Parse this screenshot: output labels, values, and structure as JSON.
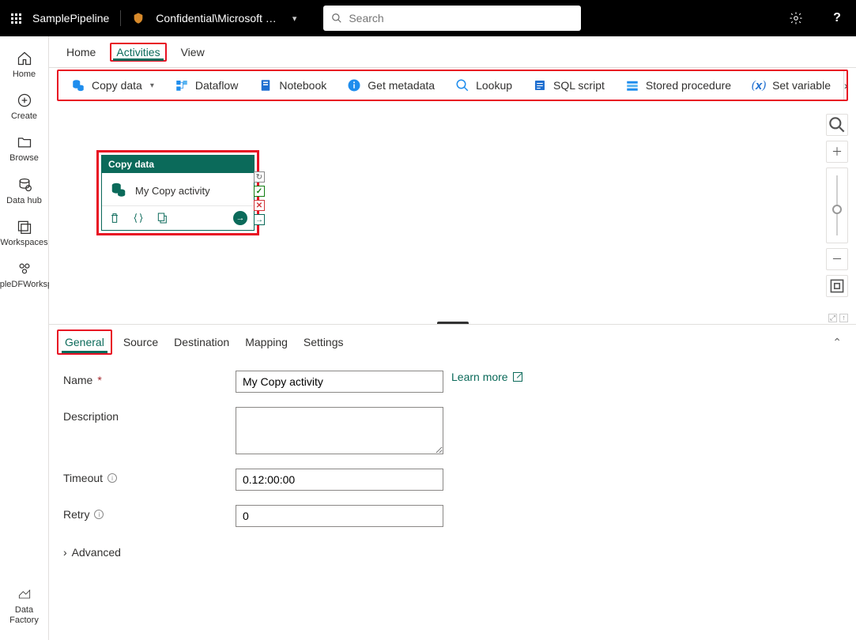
{
  "topbar": {
    "pipeline_name": "SamplePipeline",
    "workspace_label": "Confidential\\Microsoft …",
    "search_placeholder": "Search"
  },
  "leftrail": {
    "home": "Home",
    "create": "Create",
    "browse": "Browse",
    "datahub": "Data hub",
    "workspaces": "Workspaces",
    "sample_ws": "SampleDFWorkspace",
    "data_factory": "Data Factory"
  },
  "page_tabs": {
    "home": "Home",
    "activities": "Activities",
    "view": "View"
  },
  "toolbar": {
    "copy_data": "Copy data",
    "dataflow": "Dataflow",
    "notebook": "Notebook",
    "get_metadata": "Get metadata",
    "lookup": "Lookup",
    "sql_script": "SQL script",
    "stored_procedure": "Stored procedure",
    "set_variable": "Set variable"
  },
  "node": {
    "header": "Copy data",
    "name": "My Copy activity"
  },
  "prop_tabs": {
    "general": "General",
    "source": "Source",
    "destination": "Destination",
    "mapping": "Mapping",
    "settings": "Settings"
  },
  "form": {
    "name_label": "Name",
    "name_value": "My Copy activity",
    "learn_more": "Learn more",
    "description_label": "Description",
    "description_value": "",
    "timeout_label": "Timeout",
    "timeout_value": "0.12:00:00",
    "retry_label": "Retry",
    "retry_value": "0",
    "advanced": "Advanced"
  }
}
